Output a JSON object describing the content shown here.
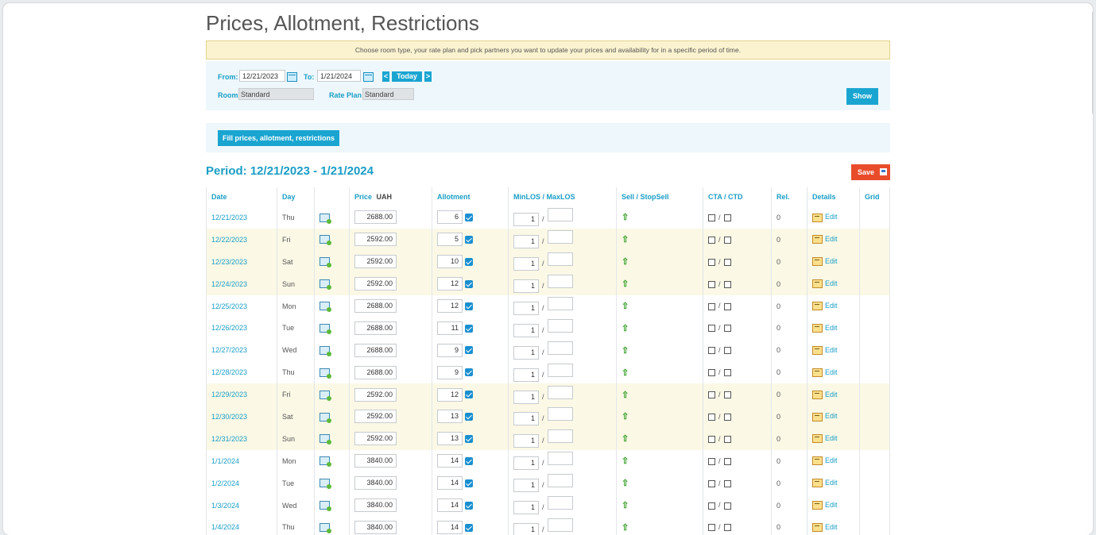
{
  "page": {
    "title": "Prices, Allotment, Restrictions",
    "notice": "Choose room type, your rate plan and pick partners you want to update your prices and availability for in a specific period of time."
  },
  "filters": {
    "from_label": "From:",
    "from_value": "12/21/2023",
    "to_label": "To:",
    "to_value": "1/21/2024",
    "prev_label": "<",
    "today_label": "Today",
    "next_label": ">",
    "room_label": "Room",
    "room_value": "Standard",
    "rateplan_label": "Rate Plan",
    "rateplan_value": "Standard",
    "show_label": "Show"
  },
  "fill_button": "Fill prices, allotment, restrictions",
  "period": "Period: 12/21/2023 - 1/21/2024",
  "save_label": "Save",
  "table": {
    "headers": {
      "date": "Date",
      "day": "Day",
      "price": "Price",
      "currency": "UAH",
      "allotment": "Allotment",
      "minmax": "MinLOS / MaxLOS",
      "sell": "Sell / StopSell",
      "ctactd": "CTA / CTD",
      "rel": "Rel.",
      "details": "Details",
      "grid": "Grid"
    },
    "edit_label": "Edit",
    "rows": [
      {
        "date": "12/21/2023",
        "day": "Thu",
        "price": "2688.00",
        "allotment": "6",
        "minlos": "1",
        "rel": "0",
        "alt": false
      },
      {
        "date": "12/22/2023",
        "day": "Fri",
        "price": "2592.00",
        "allotment": "5",
        "minlos": "1",
        "rel": "0",
        "alt": true
      },
      {
        "date": "12/23/2023",
        "day": "Sat",
        "price": "2592.00",
        "allotment": "10",
        "minlos": "1",
        "rel": "0",
        "alt": true
      },
      {
        "date": "12/24/2023",
        "day": "Sun",
        "price": "2592.00",
        "allotment": "12",
        "minlos": "1",
        "rel": "0",
        "alt": true
      },
      {
        "date": "12/25/2023",
        "day": "Mon",
        "price": "2688.00",
        "allotment": "12",
        "minlos": "1",
        "rel": "0",
        "alt": false
      },
      {
        "date": "12/26/2023",
        "day": "Tue",
        "price": "2688.00",
        "allotment": "11",
        "minlos": "1",
        "rel": "0",
        "alt": false
      },
      {
        "date": "12/27/2023",
        "day": "Wed",
        "price": "2688.00",
        "allotment": "9",
        "minlos": "1",
        "rel": "0",
        "alt": false
      },
      {
        "date": "12/28/2023",
        "day": "Thu",
        "price": "2688.00",
        "allotment": "9",
        "minlos": "1",
        "rel": "0",
        "alt": false
      },
      {
        "date": "12/29/2023",
        "day": "Fri",
        "price": "2592.00",
        "allotment": "12",
        "minlos": "1",
        "rel": "0",
        "alt": true
      },
      {
        "date": "12/30/2023",
        "day": "Sat",
        "price": "2592.00",
        "allotment": "13",
        "minlos": "1",
        "rel": "0",
        "alt": true
      },
      {
        "date": "12/31/2023",
        "day": "Sun",
        "price": "2592.00",
        "allotment": "13",
        "minlos": "1",
        "rel": "0",
        "alt": true
      },
      {
        "date": "1/1/2024",
        "day": "Mon",
        "price": "3840.00",
        "allotment": "14",
        "minlos": "1",
        "rel": "0",
        "alt": false
      },
      {
        "date": "1/2/2024",
        "day": "Tue",
        "price": "3840.00",
        "allotment": "14",
        "minlos": "1",
        "rel": "0",
        "alt": false
      },
      {
        "date": "1/3/2024",
        "day": "Wed",
        "price": "3840.00",
        "allotment": "14",
        "minlos": "1",
        "rel": "0",
        "alt": false
      },
      {
        "date": "1/4/2024",
        "day": "Thu",
        "price": "3840.00",
        "allotment": "14",
        "minlos": "1",
        "rel": "0",
        "alt": false
      }
    ]
  },
  "colors": {
    "accent": "#1aa5d1",
    "save": "#e84c2b",
    "alt_row": "#fbf8e6",
    "notice_bg": "#fbf3d0",
    "filter_bg": "#eef7fb",
    "sell_arrow": "#39a02a"
  },
  "icons": {
    "calendar": "calendar-icon",
    "save_disk": "floppy-disk-icon",
    "row_action": "row-copy-icon",
    "sell_arrow": "up-arrow-icon",
    "edit": "edit-note-icon",
    "checked": "checkbox-checked-icon",
    "unchecked": "checkbox-unchecked-icon"
  }
}
